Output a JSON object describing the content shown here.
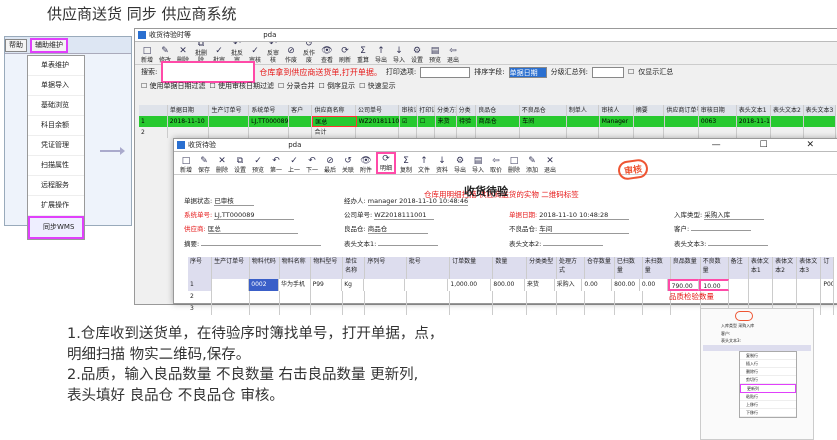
{
  "heading": "供应商送货 同步 供应商系统",
  "left_menu": {
    "toolbar": [
      {
        "label": "帮助"
      },
      {
        "label": "辅助维护"
      }
    ],
    "items": [
      "单表维护",
      "单据导入",
      "基础浏览",
      "科目余额",
      "凭证管理",
      "扫描属性",
      "远程服务",
      "扩展操作",
      "同步WMS"
    ],
    "selected": "同步WMS"
  },
  "win1": {
    "title": "收货待验时等",
    "subtitle": "pda",
    "toolbar": [
      "新增",
      "修改",
      "删除",
      "批删除",
      "批审",
      "批反审",
      "审核",
      "反审核",
      "作废",
      "反作废",
      "查看",
      "刷新",
      "重算",
      "导出",
      "导入",
      "设置",
      "预览",
      "退出"
    ],
    "search_label": "搜索:",
    "hint": "仓库拿到供应商送货单,打开单据。",
    "print_label": "打印选项:",
    "sort_label": "排序字段:",
    "sort_value": "单据日期",
    "group_label": "分级汇总列:",
    "summary_label": "仅显示汇总",
    "checks": [
      "使用单据日期过滤",
      "使用审核日期过滤",
      "分录合并",
      "倒序显示",
      "快速显示"
    ],
    "columns": [
      "单据日期",
      "生产订单号",
      "系统单号",
      "客户",
      "供应商名称",
      "公司单号",
      "审核记号",
      "打印记号",
      "分类方式",
      "分类",
      "良品仓",
      "不良品仓",
      "制单人",
      "审核人",
      "摘要",
      "供应商订单号",
      "审核日期",
      "表头文本1",
      "表头文本2",
      "表头文本3"
    ],
    "rows": [
      {
        "num": "1",
        "cells": [
          "2018-11-10",
          "",
          "LJ,TT000089",
          "",
          "匡总",
          "WZ2018111001",
          "☑",
          "☐",
          "来货",
          "待验",
          "商品仓",
          "车间",
          "",
          "Manager",
          "",
          "",
          "0063",
          "2018-11-10",
          "",
          ""
        ]
      },
      {
        "num": "2",
        "cells": [
          "",
          "",
          "",
          "",
          "合计",
          "",
          "",
          "",
          "",
          "",
          "",
          "",
          "",
          "",
          "",
          "",
          "",
          "",
          "",
          ""
        ]
      }
    ]
  },
  "win2": {
    "title": "收货待验",
    "subtitle": "pda",
    "controls": "—  ☐  ✕",
    "toolbar": [
      "新增",
      "保存",
      "删除",
      "设置",
      "预览",
      "第一",
      "上一",
      "下一",
      "最后",
      "关联",
      "附件",
      "明细",
      "复制",
      "文件",
      "资料",
      "导出",
      "导入",
      "取价",
      "删除",
      "添加",
      "退出"
    ],
    "status_label": "单据状态:",
    "status_value": "已审核",
    "maker_label": "经办人:",
    "maker_value": "manager 2018-11-10 10:48:46",
    "system_no_label": "系统单号:",
    "system_no": "LJ,TT000089",
    "company_no_label": "公司单号:",
    "company_no": "WZ2018111001",
    "date_label": "单据日期:",
    "date_value": "2018-11-10 10:48:28",
    "in_type_label": "入库类型:",
    "in_type": "采购入库",
    "supplier_label": "供应商:",
    "supplier": "匡总",
    "good_wh_label": "良品仓:",
    "good_wh": "商品仓",
    "bad_wh_label": "不良品仓:",
    "bad_wh": "车间",
    "customer_label": "客户:",
    "summary_label": "摘要:",
    "ht1_label": "表头文本1:",
    "ht2_label": "表头文本2:",
    "ht3_label": "表头文本3:",
    "form_title": "收货待验",
    "scan_hint": "仓库用明细扫描 供应商送货的实物 二维码标签",
    "audit_stamp": "审核",
    "qc_hint": "品质检验数量",
    "columns": [
      "序号",
      "生产订单号",
      "物料代码",
      "物料名称",
      "物料型号",
      "单位名称",
      "序列号",
      "批号",
      "订单数量",
      "数量",
      "分类类型",
      "处理方式",
      "仓存数量",
      "已扫数量",
      "未扫数量",
      "良品数量",
      "不良数量",
      "备注",
      "表体文本1",
      "表体文本2",
      "表体文本3",
      "订"
    ],
    "rows": [
      {
        "cells": [
          "1",
          "",
          "0002",
          "华为手机",
          "P99",
          "Kg",
          "",
          "",
          "1,000.00",
          "800.00",
          "来货",
          "采购入",
          "0.00",
          "800.00",
          "0.00",
          "790.00",
          "10.00",
          "",
          "",
          "",
          "",
          "P00"
        ]
      },
      {
        "cells": [
          "2",
          "",
          "",
          "",
          "",
          "",
          "",
          "",
          "",
          "",
          "",
          "",
          "",
          "",
          "",
          "",
          "",
          "",
          "",
          "",
          "",
          ""
        ]
      },
      {
        "cells": [
          "3",
          "",
          "",
          "",
          "",
          "",
          "",
          "",
          "",
          "",
          "",
          "",
          "",
          "",
          "",
          "",
          "",
          "",
          "",
          "",
          "",
          ""
        ]
      }
    ]
  },
  "notes": [
    "1.仓库收到送货单，在待验序时簿找单号，打开单据，点，",
    "明细扫描 物实二维码,保存。",
    "2.品质，输入良品数量 不良数量 右击良品数量 更新列,",
    "表头填好 良品仓  不良品仓 审核。"
  ],
  "thumb": {
    "header": [
      "入库类型",
      "采购入库"
    ],
    "rows": [
      "客户:",
      "表头文本3:"
    ],
    "menu": [
      "复制行",
      "插入行",
      "删除行",
      "剪切行",
      "更新列",
      "粘贴行",
      "上移行",
      "下移行"
    ],
    "highlight": "更新列"
  }
}
